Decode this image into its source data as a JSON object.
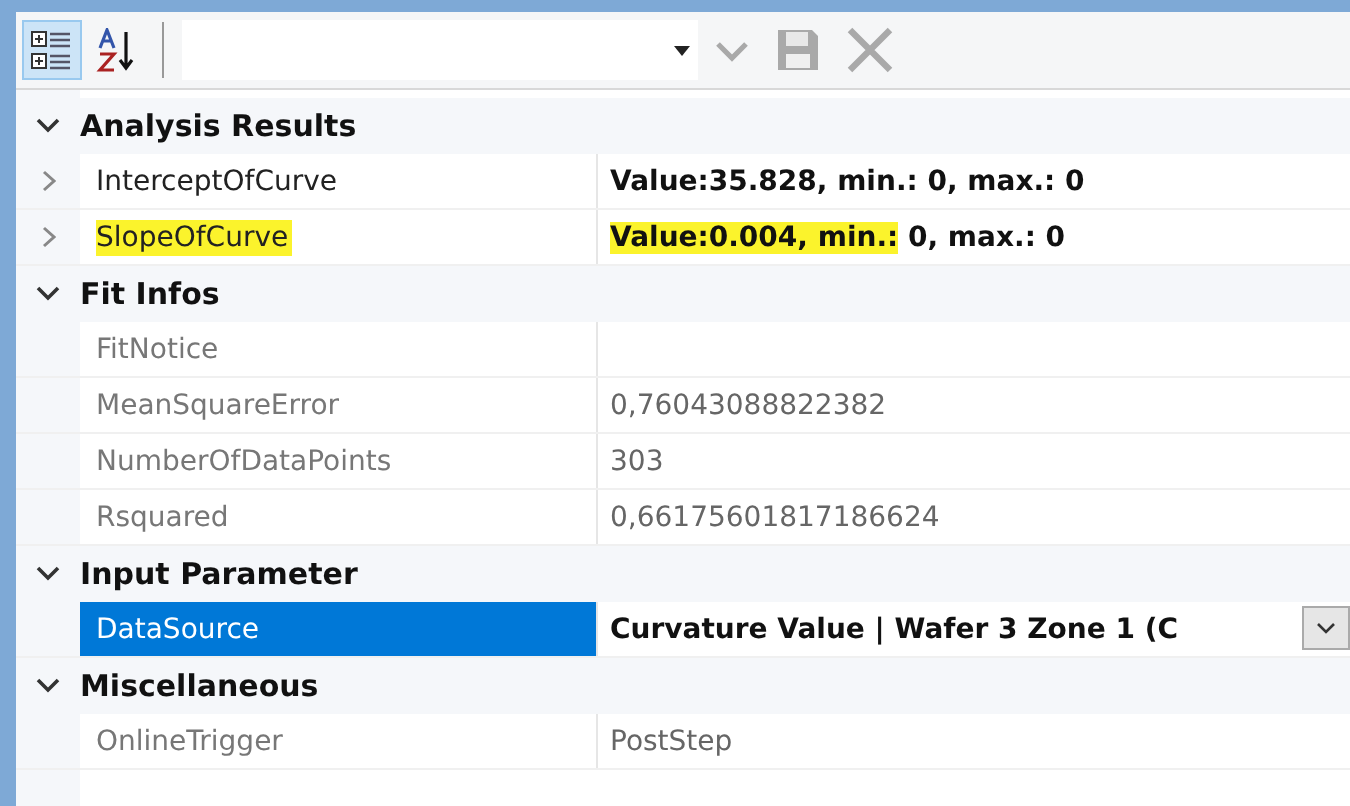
{
  "toolbar": {
    "sort_buttons": [
      {
        "kind": "categorized",
        "selected": true
      },
      {
        "kind": "alphabetical",
        "selected": false
      }
    ],
    "actions": [
      {
        "kind": "check",
        "disabled": true
      },
      {
        "kind": "save",
        "disabled": true
      },
      {
        "kind": "cancel",
        "disabled": true
      }
    ]
  },
  "categories": [
    {
      "label": "Analysis Results",
      "expanded": true,
      "rows": [
        {
          "name": "InterceptOfCurve",
          "expandable": true,
          "read_only": false,
          "modified": true,
          "selected": false,
          "highlighted": false,
          "dropdown": false,
          "value_parts": [
            {
              "text": "Value:35.828, min.: 0, max.: 0",
              "highlighted": false
            }
          ]
        },
        {
          "name": "SlopeOfCurve",
          "expandable": true,
          "read_only": false,
          "modified": true,
          "selected": false,
          "highlighted": true,
          "dropdown": false,
          "value_parts": [
            {
              "text": "Value:0.004, min.:",
              "highlighted": true
            },
            {
              "text": " 0, max.: 0",
              "highlighted": false
            }
          ]
        }
      ]
    },
    {
      "label": "Fit Infos",
      "expanded": true,
      "rows": [
        {
          "name": "FitNotice",
          "expandable": false,
          "read_only": true,
          "selected": false,
          "highlighted": false,
          "dropdown": false,
          "value_parts": []
        },
        {
          "name": "MeanSquareError",
          "expandable": false,
          "read_only": true,
          "modified": false,
          "selected": false,
          "highlighted": false,
          "dropdown": false,
          "value_parts": [
            {
              "text": "0,76043088822382",
              "highlighted": false
            }
          ]
        },
        {
          "name": "NumberOfDataPoints",
          "expandable": false,
          "read_only": true,
          "modified": false,
          "selected": false,
          "highlighted": false,
          "dropdown": false,
          "value_parts": [
            {
              "text": "303",
              "highlighted": false
            }
          ]
        },
        {
          "name": "Rsquared",
          "expandable": false,
          "read_only": true,
          "modified": false,
          "selected": false,
          "highlighted": false,
          "dropdown": false,
          "value_parts": [
            {
              "text": "0,66175601817186624",
              "highlighted": false
            }
          ]
        }
      ]
    },
    {
      "label": "Input Parameter",
      "expanded": true,
      "rows": [
        {
          "name": "DataSource",
          "expandable": false,
          "read_only": false,
          "modified": true,
          "selected": true,
          "highlighted": false,
          "dropdown": true,
          "value_parts": [
            {
              "text": "Curvature Value | Wafer 3 Zone 1 (C",
              "highlighted": false
            }
          ]
        }
      ]
    },
    {
      "label": "Miscellaneous",
      "expanded": true,
      "rows": [
        {
          "name": "OnlineTrigger",
          "expandable": false,
          "read_only": true,
          "modified": false,
          "selected": false,
          "highlighted": false,
          "dropdown": false,
          "value_parts": [
            {
              "text": "PostStep",
              "highlighted": false
            }
          ]
        }
      ]
    }
  ]
}
